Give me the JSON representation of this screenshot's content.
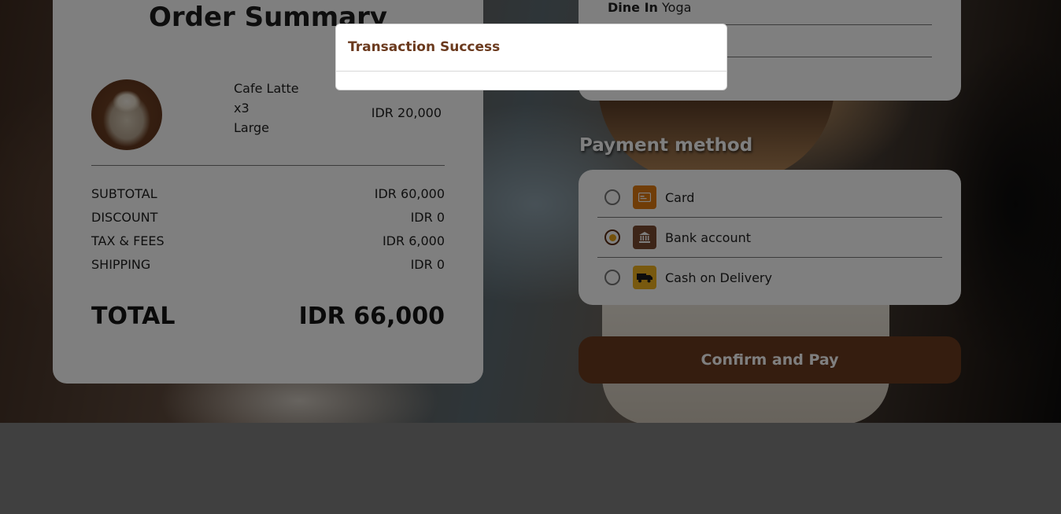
{
  "order_summary": {
    "title": "Order Summary",
    "item": {
      "name": "Cafe Latte",
      "quantity": "x3",
      "size": "Large",
      "price": "IDR 20,000"
    },
    "totals": [
      {
        "label": "SUBTOTAL",
        "value": "IDR 60,000"
      },
      {
        "label": "DISCOUNT",
        "value": "IDR 0"
      },
      {
        "label": "TAX & FEES",
        "value": "IDR 6,000"
      },
      {
        "label": "SHIPPING",
        "value": "IDR 0"
      }
    ],
    "grand_total": {
      "label": "TOTAL",
      "value": "IDR 66,000"
    }
  },
  "order_info": {
    "dine_label": "Dine In",
    "dine_value": "Yoga"
  },
  "payment": {
    "heading": "Payment method",
    "options": [
      {
        "label": "Card",
        "icon": "credit-card-icon",
        "icon_color": "#e07b10",
        "selected": false
      },
      {
        "label": "Bank account",
        "icon": "bank-icon",
        "icon_color": "#7a4a30",
        "selected": true
      },
      {
        "label": "Cash on Delivery",
        "icon": "delivery-truck-icon",
        "icon_color": "#f0b21e",
        "selected": false
      }
    ]
  },
  "confirm_button": "Confirm and Pay",
  "modal": {
    "title": "Transaction Success"
  },
  "colors": {
    "brand_brown": "#6b3a1e",
    "radio_selected": "#e8a317"
  }
}
